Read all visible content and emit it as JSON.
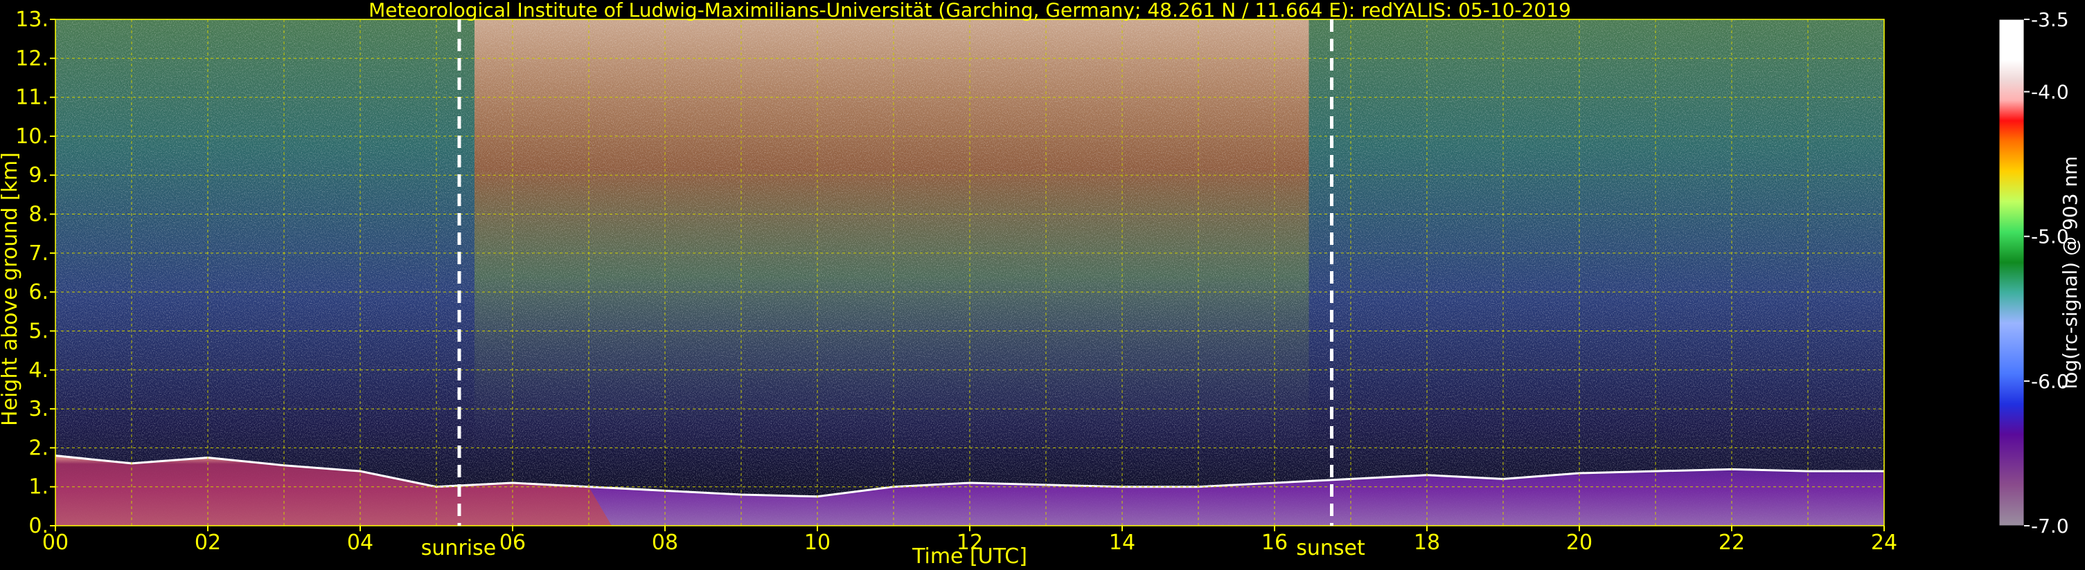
{
  "chart_data": {
    "type": "heatmap",
    "title": "Meteorological Institute of Ludwig-Maximilians-Universität (Garching, Germany; 48.261 N / 11.664 E):    redYALIS: 05-10-2019",
    "xlabel": "Time [UTC]",
    "ylabel": "Height above ground [km]",
    "xlim": [
      0,
      24
    ],
    "ylim": [
      0,
      13
    ],
    "x_ticks": [
      "00",
      "02",
      "04",
      "06",
      "08",
      "10",
      "12",
      "14",
      "16",
      "18",
      "20",
      "22",
      "24"
    ],
    "y_ticks": [
      "0.",
      "1.",
      "2.",
      "3.",
      "4.",
      "5.",
      "6.",
      "7.",
      "8.",
      "9.",
      "10.",
      "11.",
      "12.",
      "13."
    ],
    "grid": true,
    "colorbar": {
      "label": "log(rc-signal) @ 903 nm",
      "range": [
        -7.0,
        -3.5
      ],
      "ticks": [
        "-3.5",
        "-4.0",
        "-5.0",
        "-6.0",
        "-7.0"
      ]
    },
    "annotations": [
      {
        "text": "sunrise",
        "x": 5.3
      },
      {
        "text": "sunset",
        "x": 16.75
      }
    ],
    "aerosol_layer_top_km": [
      [
        0,
        1.8
      ],
      [
        1,
        1.6
      ],
      [
        2,
        1.75
      ],
      [
        3,
        1.55
      ],
      [
        4,
        1.4
      ],
      [
        5,
        1.0
      ],
      [
        6,
        1.1
      ],
      [
        7,
        1.0
      ],
      [
        8,
        0.9
      ],
      [
        9,
        0.8
      ],
      [
        10,
        0.75
      ],
      [
        11,
        1.0
      ],
      [
        12,
        1.1
      ],
      [
        13,
        1.05
      ],
      [
        14,
        1.0
      ],
      [
        15,
        1.0
      ],
      [
        16,
        1.1
      ],
      [
        17,
        1.2
      ],
      [
        18,
        1.3
      ],
      [
        19,
        1.2
      ],
      [
        20,
        1.35
      ],
      [
        21,
        1.4
      ],
      [
        22,
        1.45
      ],
      [
        23,
        1.4
      ],
      [
        24,
        1.4
      ]
    ]
  },
  "colors": {
    "text": "#ffff00",
    "grid": "#cccc00",
    "marker_line": "#ffffff",
    "background": "#000000"
  }
}
